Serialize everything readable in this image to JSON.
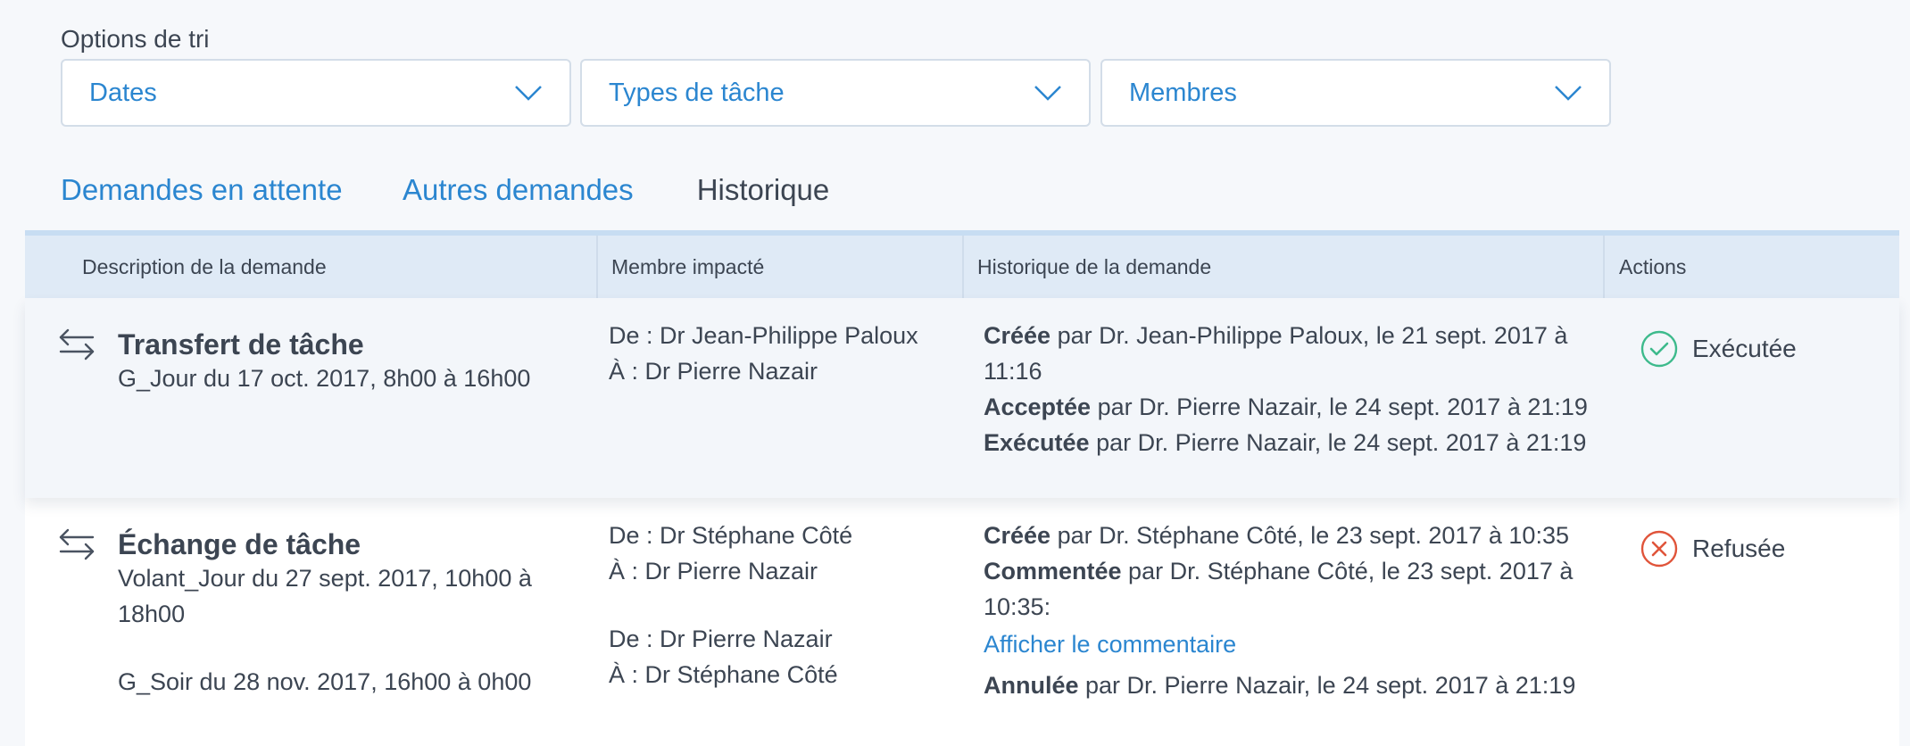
{
  "filters": {
    "label": "Options de tri",
    "dates": "Dates",
    "types": "Types de tâche",
    "members": "Membres"
  },
  "tabs": [
    {
      "label": "Demandes en attente",
      "active": false
    },
    {
      "label": "Autres demandes",
      "active": false
    },
    {
      "label": "Historique",
      "active": true
    }
  ],
  "table": {
    "headers": [
      "Description de la demande",
      "Membre impacté",
      "Historique de la demande",
      "Actions"
    ],
    "rows": [
      {
        "title": "Transfert de tâche",
        "details": [
          "G_Jour du 17 oct. 2017, 8h00 à 16h00"
        ],
        "members": [
          {
            "from": "De : Dr Jean-Philippe Paloux",
            "to": "À : Dr Pierre Nazair"
          }
        ],
        "history": [
          {
            "verb": "Créée",
            "text": " par Dr. Jean-Philippe Paloux, le 21 sept. 2017 à 11:16"
          },
          {
            "verb": "Acceptée",
            "text": " par Dr. Pierre Nazair, le 24 sept. 2017 à 21:19"
          },
          {
            "verb": "Exécutée",
            "text": " par Dr. Pierre Nazair, le 24 sept. 2017 à 21:19"
          }
        ],
        "status": "Exécutée"
      },
      {
        "title": "Échange de tâche",
        "details": [
          "Volant_Jour du 27 sept. 2017, 10h00 à 18h00",
          "G_Soir du 28 nov. 2017, 16h00 à 0h00"
        ],
        "members": [
          {
            "from": "De : Dr Stéphane Côté",
            "to": "À : Dr Pierre Nazair"
          },
          {
            "from": "De : Dr Pierre Nazair",
            "to": "À : Dr Stéphane Côté"
          }
        ],
        "history": [
          {
            "verb": "Créée",
            "text": " par Dr. Stéphane Côté, le 23 sept. 2017 à 10:35"
          },
          {
            "verb": "Commentée",
            "text": " par Dr. Stéphane Côté, le 23 sept. 2017 à 10:35:"
          },
          {
            "verb": "Annulée",
            "text": " par Dr. Pierre Nazair, le 24 sept. 2017 à 21:19"
          }
        ],
        "comment_link": "Afficher le commentaire",
        "status": "Refusée"
      }
    ]
  },
  "colors": {
    "accent": "#2b86d0",
    "tab_underline": "#3a6fb8",
    "success": "#3dba8c",
    "danger": "#e0543a"
  },
  "icons": {
    "dropdown": "chevron-down-icon",
    "swap": "swap-arrows-icon",
    "executed": "check-circle-icon",
    "refused": "x-circle-icon"
  }
}
